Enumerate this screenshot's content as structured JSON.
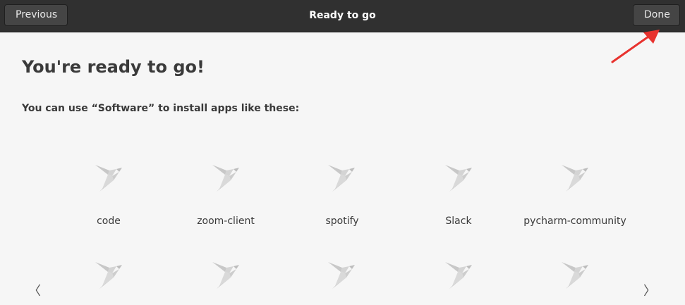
{
  "header": {
    "title": "Ready to go",
    "previous_label": "Previous",
    "done_label": "Done"
  },
  "main": {
    "heading": "You're ready to go!",
    "subtitle": "You can use “Software” to install apps like these:",
    "apps": [
      {
        "name": "code",
        "icon": "app-placeholder-icon"
      },
      {
        "name": "zoom-client",
        "icon": "app-placeholder-icon"
      },
      {
        "name": "spotify",
        "icon": "app-placeholder-icon"
      },
      {
        "name": "Slack",
        "icon": "app-placeholder-icon"
      },
      {
        "name": "pycharm-community",
        "icon": "app-placeholder-icon"
      }
    ],
    "row2_icons": 5,
    "prev_arrow": "〈",
    "next_arrow": "〉"
  },
  "colors": {
    "headerbar": "#303030",
    "background": "#f6f6f6",
    "annotation": "#e8322e"
  }
}
